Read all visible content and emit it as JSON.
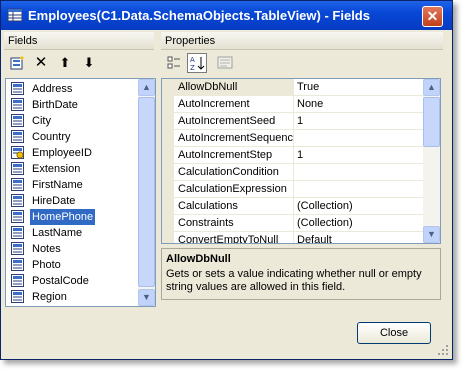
{
  "window": {
    "title": "Employees(C1.Data.SchemaObjects.TableView) - Fields"
  },
  "fields_panel": {
    "header": "Fields",
    "toolbar": [
      "add-field-icon",
      "delete-icon",
      "move-up-icon",
      "move-down-icon"
    ],
    "items": [
      {
        "label": "Address",
        "icon": "field-icon",
        "selected": false
      },
      {
        "label": "BirthDate",
        "icon": "field-icon",
        "selected": false
      },
      {
        "label": "City",
        "icon": "field-icon",
        "selected": false
      },
      {
        "label": "Country",
        "icon": "field-icon",
        "selected": false
      },
      {
        "label": "EmployeeID",
        "icon": "key-field-icon",
        "selected": false
      },
      {
        "label": "Extension",
        "icon": "field-icon",
        "selected": false
      },
      {
        "label": "FirstName",
        "icon": "field-icon",
        "selected": false
      },
      {
        "label": "HireDate",
        "icon": "field-icon",
        "selected": false
      },
      {
        "label": "HomePhone",
        "icon": "field-icon",
        "selected": true
      },
      {
        "label": "LastName",
        "icon": "field-icon",
        "selected": false
      },
      {
        "label": "Notes",
        "icon": "field-icon",
        "selected": false
      },
      {
        "label": "Photo",
        "icon": "field-icon",
        "selected": false
      },
      {
        "label": "PostalCode",
        "icon": "field-icon",
        "selected": false
      },
      {
        "label": "Region",
        "icon": "field-icon",
        "selected": false
      }
    ]
  },
  "properties_panel": {
    "header": "Properties",
    "toolbar": [
      {
        "icon": "categorized-icon",
        "pressed": false
      },
      {
        "icon": "alphabetical-icon",
        "pressed": true
      },
      {
        "icon": "property-pages-icon",
        "pressed": false
      }
    ],
    "rows": [
      {
        "name": "AllowDbNull",
        "value": "True",
        "selected": true
      },
      {
        "name": "AutoIncrement",
        "value": "None",
        "selected": false
      },
      {
        "name": "AutoIncrementSeed",
        "value": "1",
        "selected": false
      },
      {
        "name": "AutoIncrementSequenc",
        "value": "",
        "selected": false
      },
      {
        "name": "AutoIncrementStep",
        "value": "1",
        "selected": false
      },
      {
        "name": "CalculationCondition",
        "value": "",
        "selected": false
      },
      {
        "name": "CalculationExpression",
        "value": "",
        "selected": false
      },
      {
        "name": "Calculations",
        "value": "(Collection)",
        "selected": false
      },
      {
        "name": "Constraints",
        "value": "(Collection)",
        "selected": false
      },
      {
        "name": "ConvertEmptyToNull",
        "value": "Default",
        "selected": false
      }
    ],
    "description": {
      "title": "AllowDbNull",
      "text": "Gets or sets a value indicating whether null or empty string values are allowed in this field."
    }
  },
  "buttons": {
    "close": "Close"
  },
  "colors": {
    "titlebar": "#0847d6",
    "selection": "#316ac5",
    "window_bg": "#ece9d8",
    "close_x": "#c13f1c"
  }
}
